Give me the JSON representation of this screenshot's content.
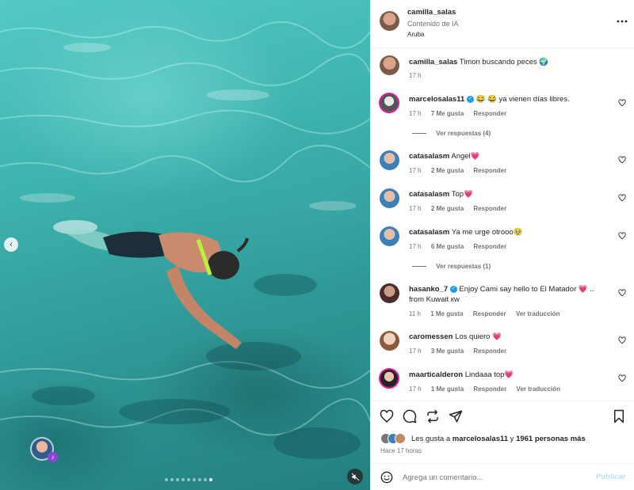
{
  "colors": {
    "accent": "#0095f6",
    "heart": "#e0245e",
    "verified": "#1d9bf0",
    "publish_disabled": "#b2dffc"
  },
  "media": {
    "slide_count": 9,
    "active_slide": 9
  },
  "header": {
    "username": "camilla_salas",
    "label": "Contenido de IA",
    "location": "Aruba"
  },
  "caption": {
    "username": "camilla_salas",
    "text": "Timon buscando peces 🌍",
    "time": "17 h"
  },
  "comments": [
    {
      "username": "marcelosalas11",
      "verified": true,
      "text": "😂 😂 ya vienen días libres.",
      "time": "17 h",
      "likes": "7 Me gusta",
      "reply": "Responder",
      "view_replies": "Ver respuestas (4)"
    },
    {
      "username": "catasalasm",
      "text": "Angel💗",
      "time": "17 h",
      "likes": "2 Me gusta",
      "reply": "Responder"
    },
    {
      "username": "catasalasm",
      "text": "Top💗",
      "time": "17 h",
      "likes": "2 Me gusta",
      "reply": "Responder"
    },
    {
      "username": "catasalasm",
      "text": "Ya me urge otrooo🥹",
      "time": "17 h",
      "likes": "6 Me gusta",
      "reply": "Responder",
      "view_replies": "Ver respuestas (1)"
    },
    {
      "username": "hasanko_7",
      "verified": true,
      "text": "Enjoy Cami say hello to El Matador 💗 ..",
      "text2": "from Kuwait кw",
      "time": "11 h",
      "likes": "1 Me gusta",
      "reply": "Responder",
      "translate": "Ver traducción"
    },
    {
      "username": "caromessen",
      "text": "Los quiero 💗",
      "time": "17 h",
      "likes": "3 Me gusta",
      "reply": "Responder"
    },
    {
      "username": "maarticalderon",
      "text": "Lindaaa top💗",
      "time": "17 h",
      "likes": "1 Me gusta",
      "reply": "Responder",
      "translate": "Ver traducción"
    }
  ],
  "likes": {
    "prefix": "Les gusta a",
    "user": "marcelosalas11",
    "joiner": "y",
    "others": "1961 personas más",
    "time": "Hace 17 horas"
  },
  "comment_box": {
    "placeholder": "Agrega un comentario...",
    "publish": "Publicar"
  }
}
